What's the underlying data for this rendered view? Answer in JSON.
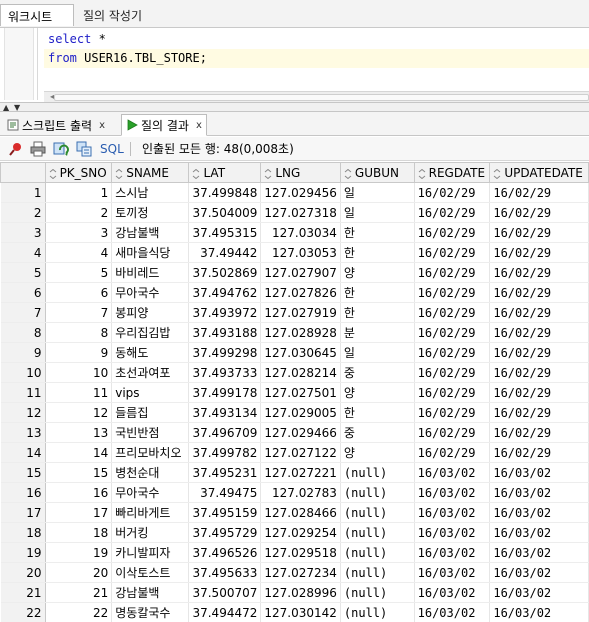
{
  "tabs": {
    "worksheet": "워크시트",
    "query_builder": "질의 작성기"
  },
  "editor": {
    "line1_kw": "select",
    "line1_rest": " *",
    "line2_kw": "from",
    "line2_rest": " USER16.TBL_STORE;"
  },
  "result_tabs": {
    "script_output": "스크립트 출력",
    "query_result": "질의 결과",
    "close": "x"
  },
  "toolbar": {
    "sql_label": "SQL",
    "status": "인출된 모든 행: 48(0,008초)"
  },
  "icons": {
    "pin": "pin-icon",
    "print": "print-icon",
    "refresh": "refresh-icon",
    "export": "export-icon",
    "run": "run-icon",
    "script": "script-icon"
  },
  "colors": {
    "keyword": "#2020c8",
    "sql_link": "#2a5db0",
    "run_green": "#2aa12a"
  },
  "grid": {
    "columns": [
      "PK_SNO",
      "SNAME",
      "LAT",
      "LNG",
      "GUBUN",
      "REGDATE",
      "UPDATEDATE"
    ],
    "rows": [
      [
        "1",
        "1",
        "스시남",
        "37.499848",
        "127.029456",
        "일",
        "16/02/29",
        "16/02/29"
      ],
      [
        "2",
        "2",
        "토끼정",
        "37.504009",
        "127.027318",
        "일",
        "16/02/29",
        "16/02/29"
      ],
      [
        "3",
        "3",
        "강남불백",
        "37.495315",
        "127.03034",
        "한",
        "16/02/29",
        "16/02/29"
      ],
      [
        "4",
        "4",
        "새마을식당",
        "37.49442",
        "127.03053",
        "한",
        "16/02/29",
        "16/02/29"
      ],
      [
        "5",
        "5",
        "바비레드",
        "37.502869",
        "127.027907",
        "양",
        "16/02/29",
        "16/02/29"
      ],
      [
        "6",
        "6",
        "무아국수",
        "37.494762",
        "127.027826",
        "한",
        "16/02/29",
        "16/02/29"
      ],
      [
        "7",
        "7",
        "봉피양",
        "37.493972",
        "127.027919",
        "한",
        "16/02/29",
        "16/02/29"
      ],
      [
        "8",
        "8",
        "우리집김밥",
        "37.493188",
        "127.028928",
        "분",
        "16/02/29",
        "16/02/29"
      ],
      [
        "9",
        "9",
        "동해도",
        "37.499298",
        "127.030645",
        "일",
        "16/02/29",
        "16/02/29"
      ],
      [
        "10",
        "10",
        "초선과여포",
        "37.493733",
        "127.028214",
        "중",
        "16/02/29",
        "16/02/29"
      ],
      [
        "11",
        "11",
        "vips",
        "37.499178",
        "127.027501",
        "양",
        "16/02/29",
        "16/02/29"
      ],
      [
        "12",
        "12",
        "들름집",
        "37.493134",
        "127.029005",
        "한",
        "16/02/29",
        "16/02/29"
      ],
      [
        "13",
        "13",
        "국빈반점",
        "37.496709",
        "127.029466",
        "중",
        "16/02/29",
        "16/02/29"
      ],
      [
        "14",
        "14",
        "프리모바치오",
        "37.499782",
        "127.027122",
        "양",
        "16/02/29",
        "16/02/29"
      ],
      [
        "15",
        "15",
        "병천순대",
        "37.495231",
        "127.027221",
        "(null)",
        "16/03/02",
        "16/03/02"
      ],
      [
        "16",
        "16",
        "무아국수",
        "37.49475",
        "127.02783",
        "(null)",
        "16/03/02",
        "16/03/02"
      ],
      [
        "17",
        "17",
        "빠리바게트",
        "37.495159",
        "127.028466",
        "(null)",
        "16/03/02",
        "16/03/02"
      ],
      [
        "18",
        "18",
        "버거킹",
        "37.495729",
        "127.029254",
        "(null)",
        "16/03/02",
        "16/03/02"
      ],
      [
        "19",
        "19",
        "카니발피자",
        "37.496526",
        "127.029518",
        "(null)",
        "16/03/02",
        "16/03/02"
      ],
      [
        "20",
        "20",
        "이삭토스트",
        "37.495633",
        "127.027234",
        "(null)",
        "16/03/02",
        "16/03/02"
      ],
      [
        "21",
        "21",
        "강남불백",
        "37.500707",
        "127.028996",
        "(null)",
        "16/03/02",
        "16/03/02"
      ],
      [
        "22",
        "22",
        "명동칼국수",
        "37.494472",
        "127.030142",
        "(null)",
        "16/03/02",
        "16/03/02"
      ]
    ]
  }
}
